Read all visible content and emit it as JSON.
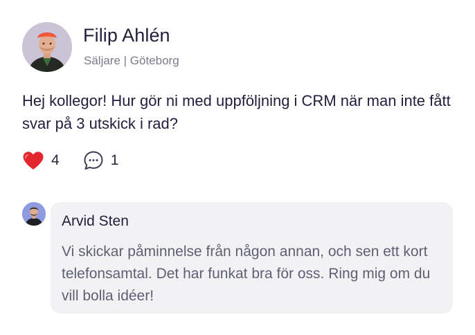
{
  "post": {
    "author": {
      "name": "Filip Ahlén",
      "meta": "Säljare | Göteborg",
      "avatar": "person-photo-red-cap"
    },
    "text": "Hej kollegor! Hur gör ni med uppföljning i CRM när man inte fått svar på 3 utskick i rad?",
    "reactions": {
      "likes": {
        "icon": "heart-icon",
        "count": "4",
        "color": "#e3262c"
      },
      "comments": {
        "icon": "speech-bubble-icon",
        "count": "1"
      }
    }
  },
  "comment": {
    "author": "Arvid Sten",
    "avatar": "person-photo-purple-background",
    "text": "Vi skickar påminnelse från någon annan, och sen ett kort telefonsamtal. Det har funkat bra för oss. Ring mig om du vill bolla idéer!"
  },
  "colors": {
    "text_primary": "#211e3b",
    "text_secondary": "#7a7a8c",
    "comment_background": "#f2f2f4",
    "heart": "#e3262c"
  }
}
